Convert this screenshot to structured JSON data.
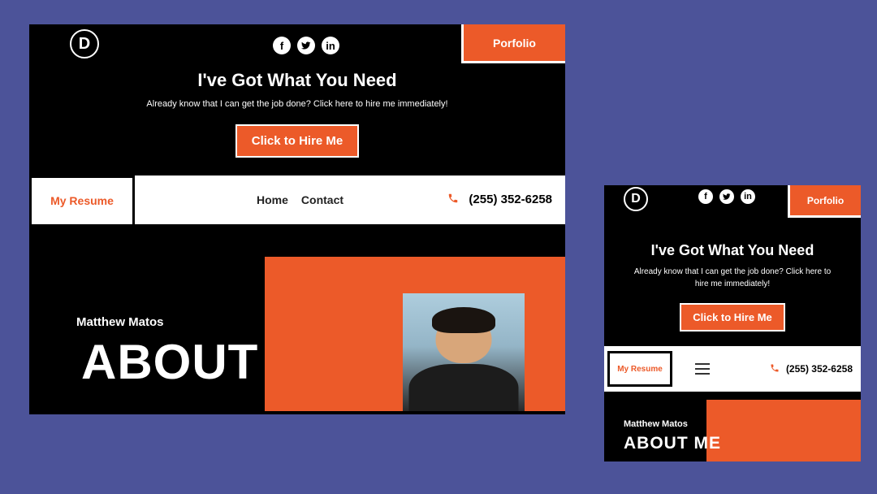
{
  "logo_letter": "D",
  "portfolio_label": "Porfolio",
  "hero": {
    "headline": "I've Got What You Need",
    "sub": "Already know that I can get the job done? Click here to hire me immediately!",
    "cta": "Click to Hire Me"
  },
  "nav": {
    "resume": "My Resume",
    "home": "Home",
    "contact": "Contact",
    "phone": "(255) 352-6258"
  },
  "about": {
    "name": "Matthew Matos",
    "big_desktop": "ABOUT",
    "big_mobile": "ABOUT ME"
  }
}
